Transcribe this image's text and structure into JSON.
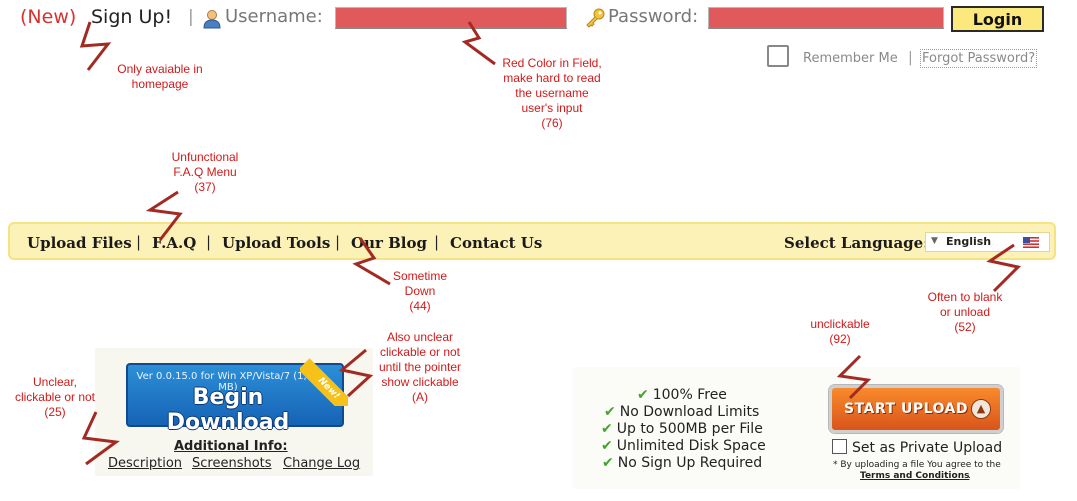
{
  "header": {
    "new_tag": "(New)",
    "signup_label": "Sign Up!",
    "separator": "|",
    "username_label": "Username:",
    "password_label": "Password:",
    "login_label": "Login",
    "remember_label": "Remember Me",
    "forgot_label": "Forgot Password?",
    "field_color": "#e05a5c"
  },
  "nav": {
    "items": [
      {
        "label": "Upload Files"
      },
      {
        "label": "F.A.Q"
      },
      {
        "label": "Upload Tools"
      },
      {
        "label": "Our Blog"
      },
      {
        "label": "Contact Us"
      }
    ],
    "separator": "|",
    "language_label": "Select Language:",
    "language_value": "English",
    "background": "#fcf1b7"
  },
  "download": {
    "version_text": "Ver 0.0.15.0 for Win XP/Vista/7 (1,39 MB)",
    "button_label": "Begin Download",
    "ribbon_label": "New!",
    "additional_info": "Additional Info:",
    "links": [
      "Description",
      "Screenshots",
      "Change Log"
    ]
  },
  "features": [
    "100% Free",
    "No Download Limits",
    "Up to 500MB per File",
    "Unlimited Disk Space",
    "No Sign Up Required"
  ],
  "upload": {
    "button_label": "START UPLOAD",
    "private_label": "Set as Private Upload",
    "terms_text": "* By uploading a file You agree to the",
    "terms_link": "Terms and Conditions",
    "terms_end": "."
  },
  "annotations": {
    "signup": [
      "Only avaiable in",
      "homepage"
    ],
    "red_field": [
      "Red Color in Field,",
      "make hard to read",
      "the username",
      "user's input",
      "(76)"
    ],
    "faq": [
      "Unfunctional",
      "F.A.Q Menu",
      "(37)"
    ],
    "blog": [
      "Sometime",
      "Down",
      "(44)"
    ],
    "language": [
      "Often to blank",
      "or unload",
      "(52)"
    ],
    "upload": [
      "unclickable",
      "(92)"
    ],
    "download_button": [
      "Also unclear",
      "clickable or not",
      "until the pointer",
      "show clickable",
      "(A)"
    ],
    "links": [
      "Unclear,",
      "clickable or not",
      "(25)"
    ],
    "color": "#d11a1a"
  }
}
